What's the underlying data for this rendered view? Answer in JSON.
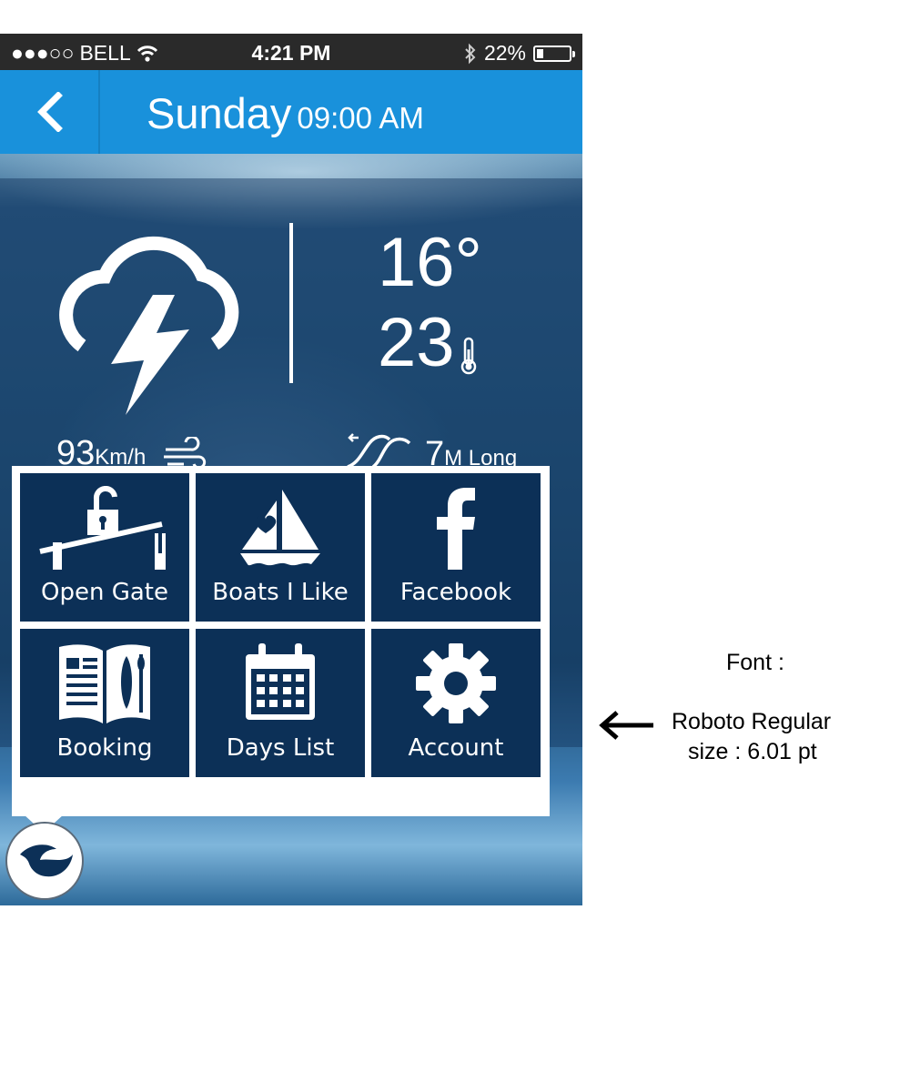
{
  "status_bar": {
    "signal": "●●●○○",
    "carrier": "BELL",
    "time": "4:21 PM",
    "battery": "22%",
    "battery_level": 0.22,
    "icons": [
      "wifi-icon",
      "bluetooth-icon",
      "battery-icon"
    ]
  },
  "header": {
    "day": "Sunday",
    "time": "09:00 AM",
    "background": "#1991db"
  },
  "weather": {
    "condition_icon": "thunderstorm-icon",
    "temp_high": "16°",
    "temp_low": "23",
    "wind_speed": "93",
    "wind_unit": "Km/h",
    "wave_height": "7",
    "wave_unit": "M Long"
  },
  "menu": {
    "tile_color": "#0c3057",
    "items": [
      {
        "label": "Open Gate",
        "icon": "gate-unlock-icon"
      },
      {
        "label": "Boats I Like",
        "icon": "sailboat-heart-icon"
      },
      {
        "label": "Facebook",
        "icon": "facebook-icon"
      },
      {
        "label": "Booking",
        "icon": "booklet-icon"
      },
      {
        "label": "Days List",
        "icon": "calendar-icon"
      },
      {
        "label": "Account",
        "icon": "gear-icon"
      }
    ]
  },
  "annotation": {
    "title": "Font :",
    "line1": "Roboto Regular",
    "line2": "size : 6.01 pt"
  }
}
